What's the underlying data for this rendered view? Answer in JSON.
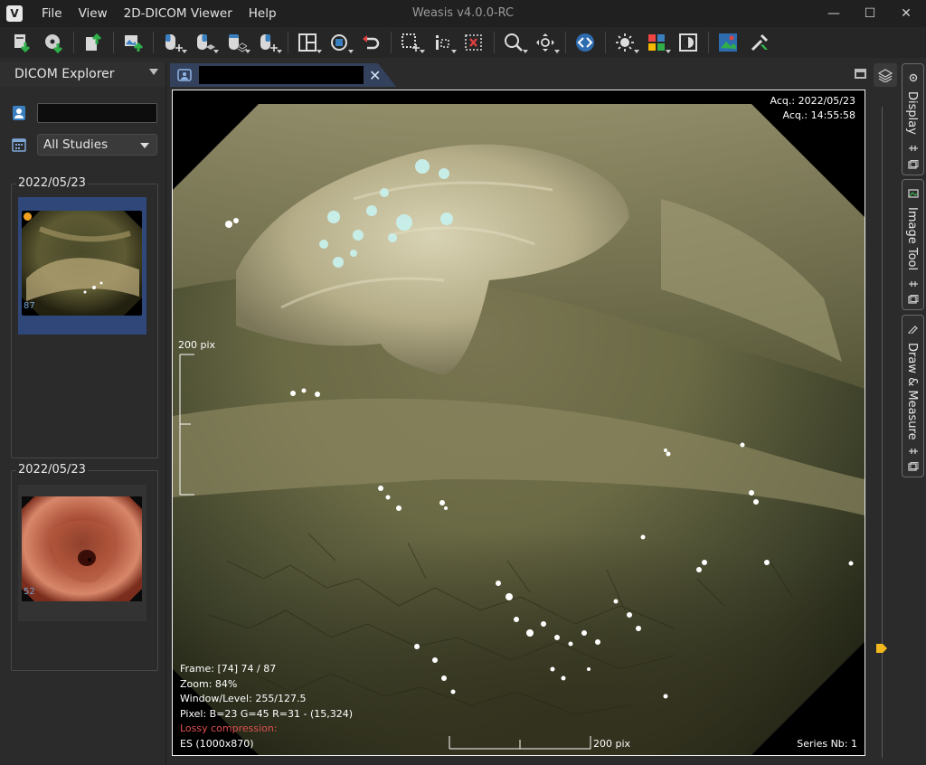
{
  "window": {
    "title": "Weasis v4.0.0-RC",
    "menu": [
      "File",
      "View",
      "2D-DICOM Viewer",
      "Help"
    ],
    "controls": {
      "minimize": "—",
      "maximize": "☐",
      "close": "✕"
    }
  },
  "toolbar": {
    "buttons": [
      "import-dicom",
      "open-cd",
      "export-dicom",
      "export-image",
      "move-tool",
      "layout-sync",
      "stack-tool",
      "mouse-tool",
      "layout",
      "rotate",
      "reset",
      "select-zoom",
      "measure",
      "delete",
      "zoom",
      "pan",
      "sync",
      "window-level",
      "lut",
      "invert",
      "settings",
      "info"
    ]
  },
  "explorer": {
    "title": "DICOM Explorer",
    "patient_value": "",
    "study_filter": "All Studies",
    "studies": [
      {
        "date": "2022/05/23",
        "series": [
          {
            "count": "87"
          }
        ]
      },
      {
        "date": "2022/05/23",
        "series": [
          {
            "count": "52"
          }
        ]
      }
    ]
  },
  "viewer": {
    "tab_name": "",
    "overlay": {
      "acq_date": "Acq.: 2022/05/23",
      "acq_time": "Acq.: 14:55:58",
      "scale_left": "200 pix",
      "frame": "Frame: [74] 74 / 87",
      "zoom": "Zoom: 84%",
      "window_level": "Window/Level: 255/127.5",
      "pixel": "Pixel:  B=23 G=45 R=31 - (15,324)",
      "lossy": "Lossy compression:",
      "modality": "ES (1000x870)",
      "scale_bottom": "200 pix",
      "series_nb": "Series Nb: 1"
    }
  },
  "side_panels": {
    "display": "Display",
    "image_tool": "Image Tool",
    "draw_measure": "Draw & Measure"
  }
}
